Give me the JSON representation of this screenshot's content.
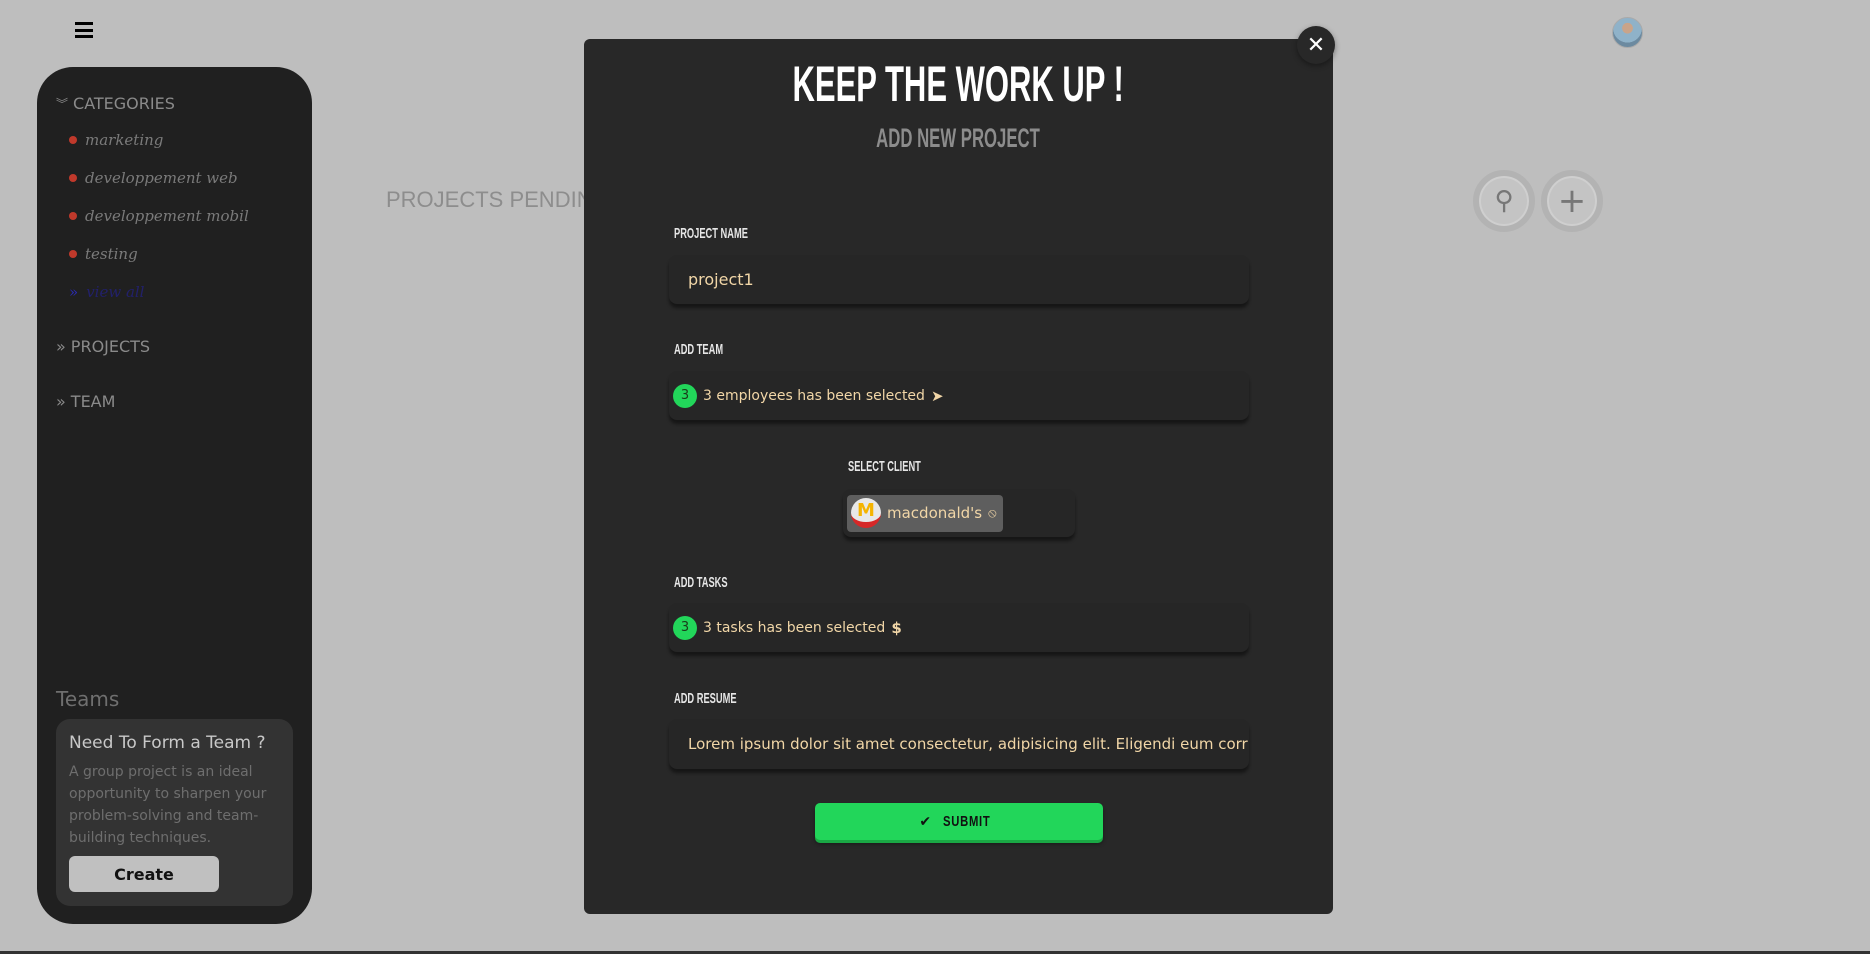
{
  "header": {
    "menu_icon": "hamburger-icon",
    "avatar_icon": "user-avatar"
  },
  "sidebar": {
    "categories_label": "CATEGORIES",
    "categories": [
      {
        "label": "marketing"
      },
      {
        "label": "developpement web"
      },
      {
        "label": "developpement mobil"
      },
      {
        "label": "testing"
      }
    ],
    "view_all": "view all",
    "projects_label": "PROJECTS",
    "team_label": "TEAM",
    "teams_heading": "Teams",
    "card": {
      "title": "Need To Form a Team ?",
      "text": "A group project is an ideal opportunity to sharpen your problem-solving and team-building techniques.",
      "button": "Create"
    },
    "category_dot_color": "#c0392b"
  },
  "main": {
    "heading": "PROJECTS PENDIN",
    "search_icon": "search-icon",
    "add_icon": "plus-icon"
  },
  "modal": {
    "title": "KEEP THE WORK UP !",
    "subtitle": "ADD NEW PROJECT",
    "project_name_label": "PROJECT NAME",
    "project_name_value": "project1",
    "team_label": "ADD TEAM",
    "team_count": "3",
    "team_text": "3 employees has been selected",
    "client_label": "SELECT CLIENT",
    "client_value": "macdonald's",
    "tasks_label": "ADD TASKS",
    "tasks_count": "3",
    "tasks_text": "3 tasks has been selected",
    "resume_label": "ADD RESUME",
    "resume_value": "Lorem ipsum dolor sit amet consectetur, adipisicing elit. Eligendi eum corru",
    "submit": "SUBMIT",
    "accent": "#22d65a"
  }
}
